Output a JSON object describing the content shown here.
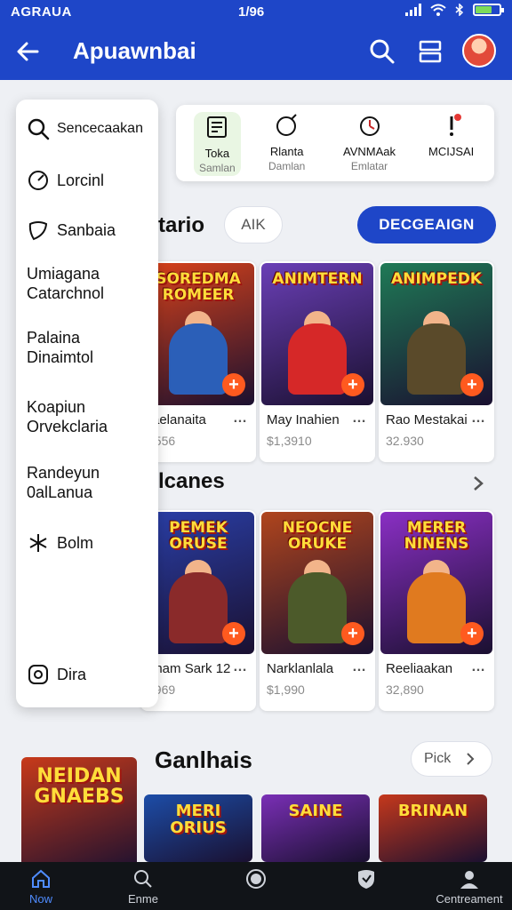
{
  "status_bar": {
    "carrier": "AGRAUA",
    "carrier_suffix": "🅒",
    "time": "1/96",
    "battery_level": 0.7
  },
  "app_bar": {
    "title": "Apuawnbai",
    "back_icon": "arrow-left-icon",
    "search_icon": "search-icon",
    "menu_icon": "grid-icon"
  },
  "drawer": {
    "search_label": "Sencecaakan",
    "items": [
      {
        "label": "Lorcinl",
        "icon": "clock-icon"
      },
      {
        "label": "Sanbaia",
        "icon": "shield-icon"
      },
      {
        "label": "Umiagana",
        "label2": "Catarchnol"
      },
      {
        "label": "Palaina",
        "label2": "Dinaimtol"
      },
      {
        "label": "Koapiun",
        "label2": "Orvekclaria"
      },
      {
        "label": "Randeyun",
        "label2": "0alLanua"
      },
      {
        "label": "Bolm",
        "icon": "star-icon"
      },
      {
        "label": "Dira",
        "icon": "ring-icon"
      }
    ]
  },
  "categories": [
    {
      "label": "Toka",
      "sub": "Samlan"
    },
    {
      "label": "Rlanta",
      "sub": "Damlan"
    },
    {
      "label": "AVNMAak",
      "sub": "Emlatar"
    },
    {
      "label": "MCIJSAI",
      "sub": ""
    }
  ],
  "filters": {
    "section_partial": "tario",
    "ghost_chip": "AIK",
    "primary_chip": "DECGEAIGN"
  },
  "row1": [
    {
      "name": "raelanaita",
      "price": "1556",
      "logo": "SOREDMA ROMEER",
      "bg": "#d9421a",
      "hero": "#2b5fb8"
    },
    {
      "name": "May Inahien",
      "price": "$1,3910",
      "logo": "ANIMTERN",
      "bg": "#6a3fb6",
      "hero": "#d62828"
    },
    {
      "name": "Rao Mestakai",
      "price": "32.930",
      "logo": "ANIMPEDK",
      "bg": "#1f7a56",
      "hero": "#5a4a2a"
    }
  ],
  "section2_partial": "lcanes",
  "row2": [
    {
      "name": "aham Sark 12",
      "price": "1969",
      "logo": "PEMEK ORUSE",
      "bg": "#2a3fa8",
      "hero": "#8a2a2a"
    },
    {
      "name": "Narklanlala",
      "price": "$1,990",
      "logo": "NEOCNE ORUKE",
      "bg": "#b0451d",
      "hero": "#4c5a2a"
    },
    {
      "name": "Reeliaakan",
      "price": "32,890",
      "logo": "MERER NINENS",
      "bg": "#8a2fc4",
      "hero": "#e07a1f"
    }
  ],
  "section3": {
    "title": "Ganlhais",
    "pill": "Pick"
  },
  "row3": [
    {
      "logo": "NEIDAN GNAEBS",
      "bg": "#c83a1a"
    },
    {
      "logo": "MERI ORIUS",
      "bg": "#1c4da8"
    },
    {
      "logo": "SAINE",
      "bg": "#7a2fb6"
    },
    {
      "logo": "BRINAN",
      "bg": "#c5381c"
    }
  ],
  "bottom_nav": [
    {
      "label": "Now",
      "icon": "home-icon",
      "active": true
    },
    {
      "label": "Enme",
      "icon": "search-icon",
      "active": false
    },
    {
      "label": "",
      "icon": "circle-icon",
      "active": false
    },
    {
      "label": "",
      "icon": "shield-icon",
      "active": false
    },
    {
      "label": "Centreament",
      "icon": "profile-icon",
      "active": false
    }
  ]
}
